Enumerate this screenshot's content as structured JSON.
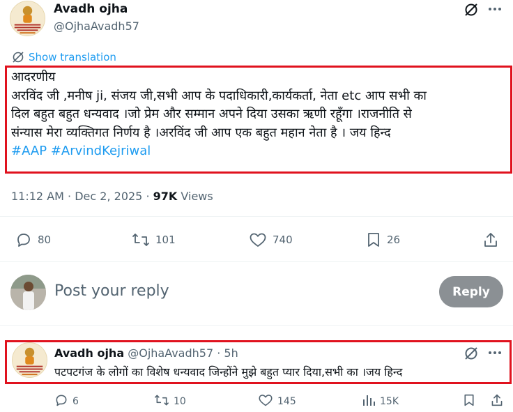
{
  "tweet": {
    "author_name": "Avadh ojha",
    "author_handle": "@OjhaAvadh57",
    "show_translation": "Show translation",
    "lines": [
      "आदरणीय",
      "अरविंद जी ,मनीष ji, संजय जी,सभी आप के पदाधिकारी,कार्यकर्ता, नेता etc आप सभी का",
      "दिल बहुत बहुत धन्यवाद ।जो प्रेम और सम्मान अपने दिया उसका ऋणी रहूँगा ।राजनीति से",
      "संन्यास मेरा व्यक्तिगत निर्णय है ।अरविंद जी आप एक बहुत महान नेता है । जय हिन्द"
    ],
    "hashtags": [
      "#AAP",
      "#ArvindKejriwal"
    ],
    "time": "11:12 AM",
    "date": "Dec 2, 2025",
    "views_count": "97K",
    "views_label": "Views",
    "dot": "·",
    "stats": {
      "replies": "80",
      "reposts": "101",
      "likes": "740",
      "bookmarks": "26"
    }
  },
  "composer": {
    "placeholder": "Post your reply",
    "button": "Reply"
  },
  "reply": {
    "author_name": "Avadh ojha",
    "author_handle": "@OjhaAvadh57",
    "dot": "·",
    "age": "5h",
    "text": "पटपटगंज के लोगों का विशेष धन्यवाद जिन्होंने मुझे बहुत प्यार दिया,सभी का ।जय हिन्द",
    "stats": {
      "replies": "6",
      "reposts": "10",
      "likes": "145",
      "views": "15K"
    }
  },
  "colors": {
    "accent": "#1d9bf0",
    "highlight_box": "#e0121e",
    "reply_button": "#8b9094",
    "secondary_text": "#536471"
  }
}
